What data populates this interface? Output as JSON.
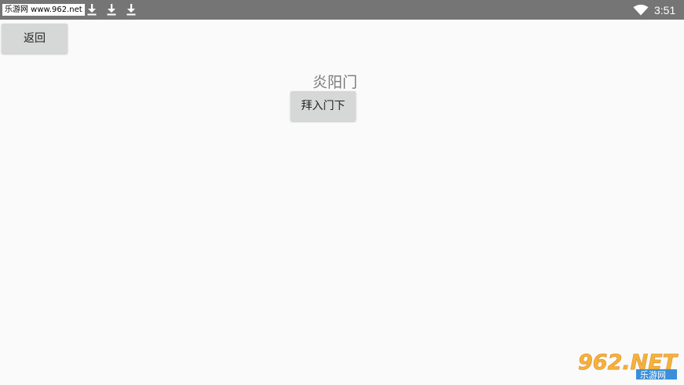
{
  "status_bar": {
    "site_badge": "乐游网 www.962.net",
    "time": "3:51",
    "download_icons": [
      "download-icon",
      "download-icon",
      "download-icon"
    ],
    "wifi_icon": "wifi-icon",
    "background": "#757575"
  },
  "main": {
    "back_label": "返回",
    "sect_title": "炎阳门",
    "join_label": "拜入门下",
    "background": "#fafafa",
    "button_color": "#d6d7d7"
  },
  "watermark": {
    "top_text": "962.NET",
    "bottom_text": "乐游网"
  }
}
